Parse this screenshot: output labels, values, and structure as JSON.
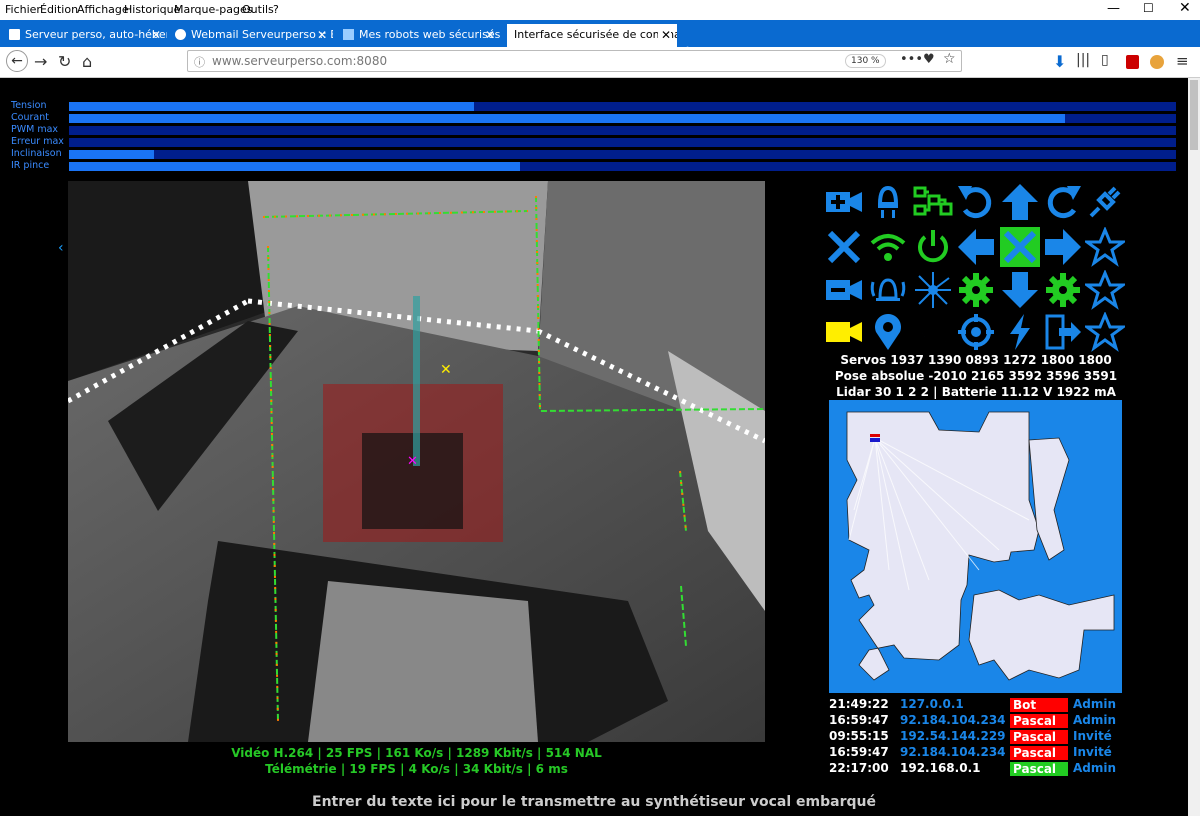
{
  "menu": [
    "Fichier",
    "Édition",
    "Affichage",
    "Historique",
    "Marque-pages",
    "Outils",
    "?"
  ],
  "tabs": [
    {
      "label": "Serveur perso, auto-hébergem"
    },
    {
      "label": "Webmail Serveurperso :: Boîte d"
    },
    {
      "label": "Mes robots web sécurisés avec"
    },
    {
      "label": "Interface sécurisée de commande d"
    }
  ],
  "url": "www.serveurperso.com:8080",
  "zoom": "130 %",
  "bars": [
    {
      "label": "Tension",
      "value": 0.366
    },
    {
      "label": "Courant",
      "value": 0.9
    },
    {
      "label": "PWM max",
      "value": 0
    },
    {
      "label": "Erreur max",
      "value": 0
    },
    {
      "label": "Inclinaison",
      "value": 0.077
    },
    {
      "label": "IR pince",
      "value": 0.407
    }
  ],
  "video_status": "Vidéo H.264 | 25 FPS | 161 Ko/s | 1289 Kbit/s | 514 NAL",
  "telemetry_status": "Télémétrie | 19 FPS | 4 Ko/s | 34 Kbit/s | 6 ms",
  "servos": "Servos 1937 1390 0893 1272 1800 1800",
  "pose": "Pose absolue -2010 2165 3592 3596 3591",
  "lidar": "Lidar 30 1 2 2 | Batterie 11.12 V 1922 mA",
  "users": [
    {
      "time": "21:49:22",
      "ip": "127.0.0.1",
      "name": "Bot",
      "role": "Admin",
      "name_bg": "#ff0000"
    },
    {
      "time": "16:59:47",
      "ip": "92.184.104.234",
      "name": "Pascal",
      "role": "Admin",
      "name_bg": "#ff0000"
    },
    {
      "time": "09:55:15",
      "ip": "192.54.144.229",
      "name": "Pascal",
      "role": "Invité",
      "name_bg": "#ff0000"
    },
    {
      "time": "16:59:47",
      "ip": "92.184.104.234",
      "name": "Pascal",
      "role": "Invité",
      "name_bg": "#ff0000"
    },
    {
      "time": "22:17:00",
      "ip": "192.168.0.1",
      "name": "Pascal",
      "role": "Admin",
      "name_bg": "#22cc22"
    }
  ],
  "tts_placeholder": "Entrer du texte ici pour le transmettre au synthétiseur vocal embarqué",
  "colors": {
    "icon_blue": "#1a86e8",
    "icon_green": "#22cc22",
    "icon_yellow": "#ffee00",
    "accent": "#0a6ad0"
  },
  "icon_grid": [
    [
      "camera-plus-icon",
      "light-icon",
      "diagram-icon",
      "rotate-left-icon",
      "arrow-up-icon",
      "rotate-right-icon",
      "plug-icon"
    ],
    [
      "close-icon",
      "wifi-icon",
      "power-icon",
      "arrow-left-icon",
      "stop-icon",
      "arrow-right-icon",
      "star-icon"
    ],
    [
      "camera-icon",
      "alarm-icon",
      "laser-icon",
      "gear-icon",
      "arrow-down-icon",
      "gear-icon",
      "star-icon"
    ],
    [
      "video-icon",
      "location-icon",
      "sleep-icon",
      "target-icon",
      "bolt-icon",
      "exit-icon",
      "star-icon"
    ]
  ]
}
